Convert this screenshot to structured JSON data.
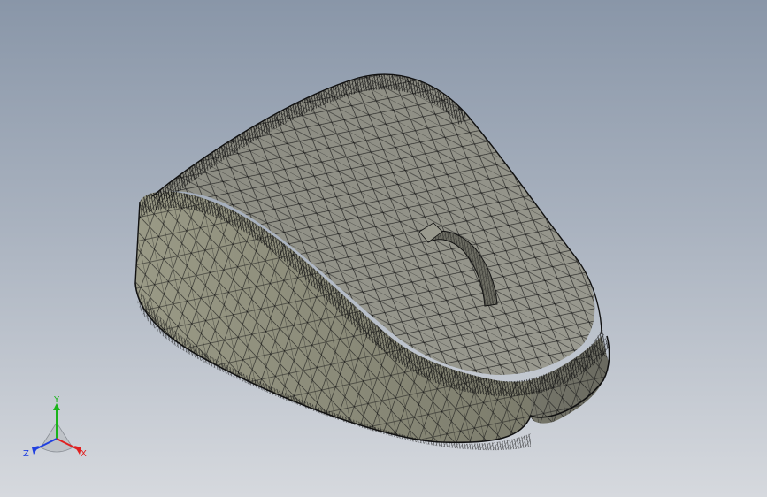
{
  "viewport": {
    "background_top": "#8996a8",
    "background_bottom": "#d6d9de"
  },
  "model": {
    "name": "mouse-shell-mesh",
    "render_style": "shaded-with-edges",
    "face_color": "#8e8e80",
    "edge_color": "#111111"
  },
  "triad": {
    "x_label": "X",
    "y_label": "Y",
    "z_label": "Z",
    "x_color": "#e02020",
    "y_color": "#19b419",
    "z_color": "#2040e0"
  }
}
